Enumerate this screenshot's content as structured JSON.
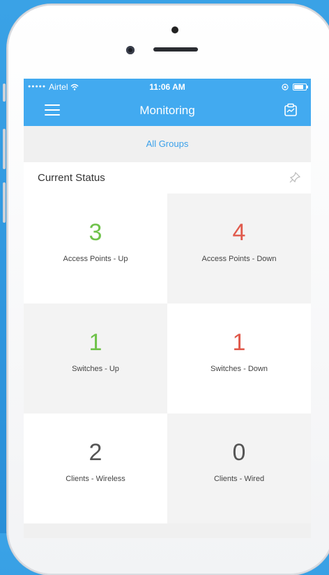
{
  "status_bar": {
    "carrier": "Airtel",
    "time": "11:06 AM"
  },
  "nav": {
    "title": "Monitoring",
    "menu_icon": "hamburger-icon",
    "right_icon": "clipboard-chart-icon"
  },
  "group_filter": {
    "label": "All Groups"
  },
  "section": {
    "title": "Current Status",
    "pin_icon": "pin-icon"
  },
  "tiles": [
    {
      "value": "3",
      "label": "Access Points - Up",
      "color": "#6fc24a"
    },
    {
      "value": "4",
      "label": "Access Points - Down",
      "color": "#e05a4c"
    },
    {
      "value": "1",
      "label": "Switches - Up",
      "color": "#6fc24a"
    },
    {
      "value": "1",
      "label": "Switches - Down",
      "color": "#e05a4c"
    },
    {
      "value": "2",
      "label": "Clients - Wireless",
      "color": "#555555"
    },
    {
      "value": "0",
      "label": "Clients - Wired",
      "color": "#555555"
    }
  ],
  "colors": {
    "accent": "#42aaf0",
    "up": "#6fc24a",
    "down": "#e05a4c"
  }
}
